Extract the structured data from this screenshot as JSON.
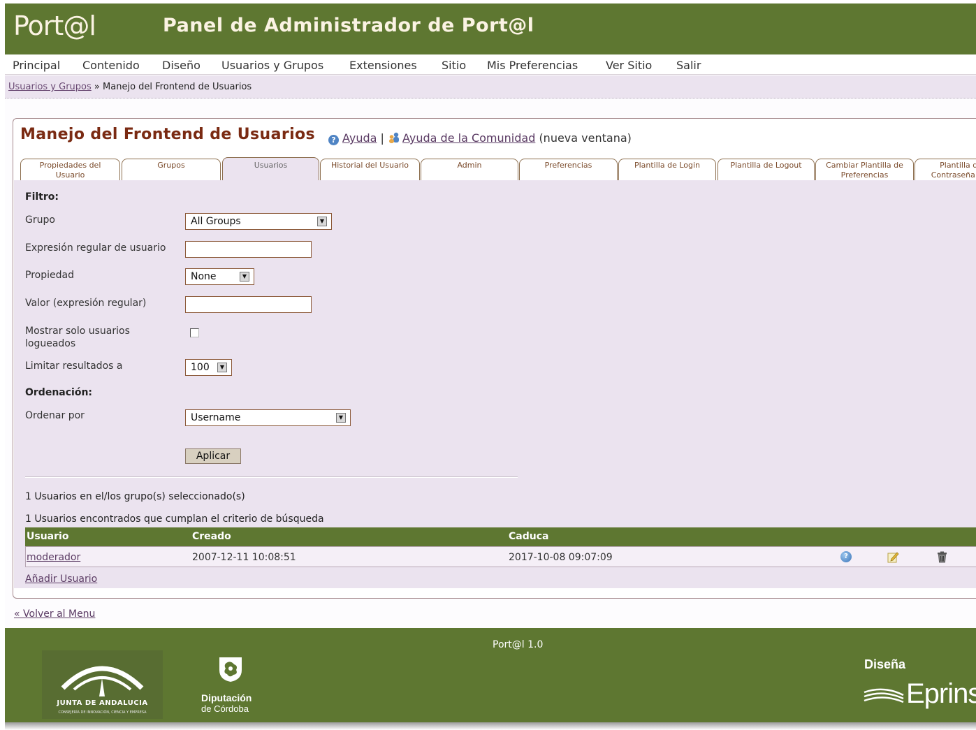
{
  "header": {
    "logo": "Port@l",
    "title": "Panel de Administrador de Port@l"
  },
  "menu": [
    "Principal",
    "Contenido",
    "Diseño",
    "Usuarios y Grupos",
    "Extensiones",
    "Sitio",
    "Mis Preferencias",
    "Ver Sitio",
    "Salir"
  ],
  "breadcrumb": {
    "link": "Usuarios y Grupos",
    "separator": "»",
    "current": "Manejo del Frontend de Usuarios"
  },
  "main": {
    "title": "Manejo del Frontend de Usuarios",
    "help": "Ayuda",
    "help_separator": "|",
    "community_help": "Ayuda de la Comunidad",
    "new_window": "(nueva ventana)"
  },
  "tabs": [
    {
      "label": "Propiedades del\nUsuario"
    },
    {
      "label": "Grupos"
    },
    {
      "label": "Usuarios",
      "active": true
    },
    {
      "label": "Historial del Usuario"
    },
    {
      "label": "Admin"
    },
    {
      "label": "Preferencias"
    },
    {
      "label": "Plantilla de Login"
    },
    {
      "label": "Plantilla de Logout"
    },
    {
      "label": "Cambiar Plantilla de\nPreferencias"
    },
    {
      "label": "Plantilla de\nContraseña P"
    }
  ],
  "filter": {
    "heading": "Filtro:",
    "group_label": "Grupo",
    "group_value": "All Groups",
    "user_regex_label": "Expresión regular de usuario",
    "user_regex_value": "",
    "property_label": "Propiedad",
    "property_value": "None",
    "value_label": "Valor (expresión regular)",
    "value_value": "",
    "logged_label_1": "Mostrar solo usuarios",
    "logged_label_2": "logueados",
    "logged_checked": false,
    "limit_label": "Limitar resultados a",
    "limit_value": "100"
  },
  "ordering": {
    "heading": "Ordenación:",
    "order_label": "Ordenar por",
    "order_value": "Username",
    "apply_label": "Aplicar"
  },
  "results": {
    "in_groups": "1 Usuarios en el/los grupo(s) seleccionado(s)",
    "found": "1 Usuarios encontrados que cumplan el criterio de búsqueda"
  },
  "table": {
    "headers": [
      "Usuario",
      "Creado",
      "Caduca"
    ],
    "rows": [
      {
        "user": "moderador",
        "created": "2007-12-11 10:08:51",
        "expires": "2017-10-08 09:07:09"
      }
    ]
  },
  "add_user": "Añadir Usuario",
  "back": "« Volver al Menu",
  "footer": {
    "version": "Port@l 1.0",
    "junta_name": "JUNTA DE ANDALUCIA",
    "junta_sub": "CONSEJERÍA DE INNOVACIÓN, CIENCIA Y EMPRESA",
    "dip_name": "Diputación",
    "dip_sub": "de Córdoba",
    "disena": "Diseña",
    "eprins": "Eprins"
  },
  "colors": {
    "header_green": "#5e7731",
    "panel_lilac": "#ebe3ef",
    "title_brown": "#7a2a12",
    "link_purple": "#5a3a63"
  }
}
